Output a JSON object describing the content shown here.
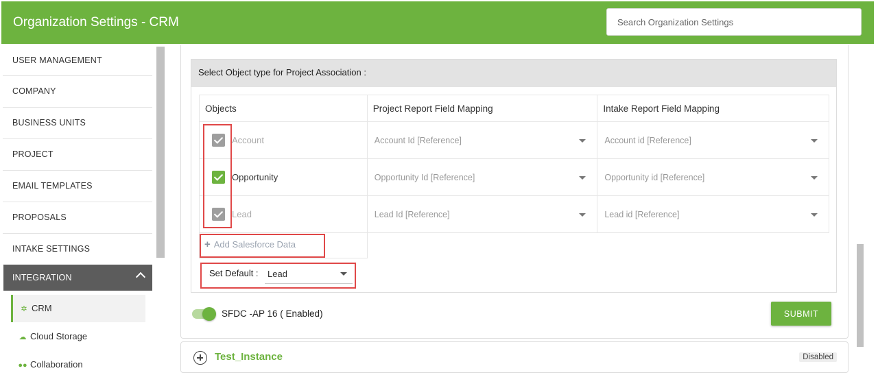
{
  "header": {
    "title": "Organization Settings - CRM",
    "search_placeholder": "Search Organization Settings"
  },
  "sidebar": {
    "items": [
      {
        "label": "USER MANAGEMENT"
      },
      {
        "label": "COMPANY"
      },
      {
        "label": "BUSINESS UNITS"
      },
      {
        "label": "PROJECT"
      },
      {
        "label": "EMAIL TEMPLATES"
      },
      {
        "label": "PROPOSALS"
      },
      {
        "label": "INTAKE SETTINGS"
      }
    ],
    "active_section": {
      "label": "INTEGRATION",
      "icon": "chevron-up-icon"
    },
    "sub_items": [
      {
        "label": "CRM",
        "icon": "gears-icon",
        "active": true
      },
      {
        "label": "Cloud Storage",
        "icon": "cloud-icon",
        "active": false
      },
      {
        "label": "Collaboration",
        "icon": "users-icon",
        "active": false
      }
    ]
  },
  "association": {
    "heading": "Select Object type for Project Association :",
    "columns": [
      "Objects",
      "Project Report Field Mapping",
      "Intake Report Field Mapping"
    ],
    "rows": [
      {
        "object": "Account",
        "checked": true,
        "enabled": false,
        "project_mapping": "Account Id [Reference]",
        "intake_mapping": "Account id [Reference]"
      },
      {
        "object": "Opportunity",
        "checked": true,
        "enabled": true,
        "project_mapping": "Opportunity Id [Reference]",
        "intake_mapping": "Opportunity id [Reference]"
      },
      {
        "object": "Lead",
        "checked": true,
        "enabled": false,
        "project_mapping": "Lead Id [Reference]",
        "intake_mapping": "Lead id [Reference]"
      }
    ],
    "add_label": "Add Salesforce Data",
    "default_label": "Set Default :",
    "default_value": "Lead"
  },
  "connection": {
    "label": "SFDC -AP 16 ( Enabled)",
    "enabled": true,
    "submit_label": "SUBMIT"
  },
  "instance": {
    "name": "Test_Instance",
    "status": "Disabled"
  },
  "colors": {
    "brand_green": "#6db33f",
    "sidebar_active": "#5c5c5c",
    "highlight_red": "#e04848"
  }
}
